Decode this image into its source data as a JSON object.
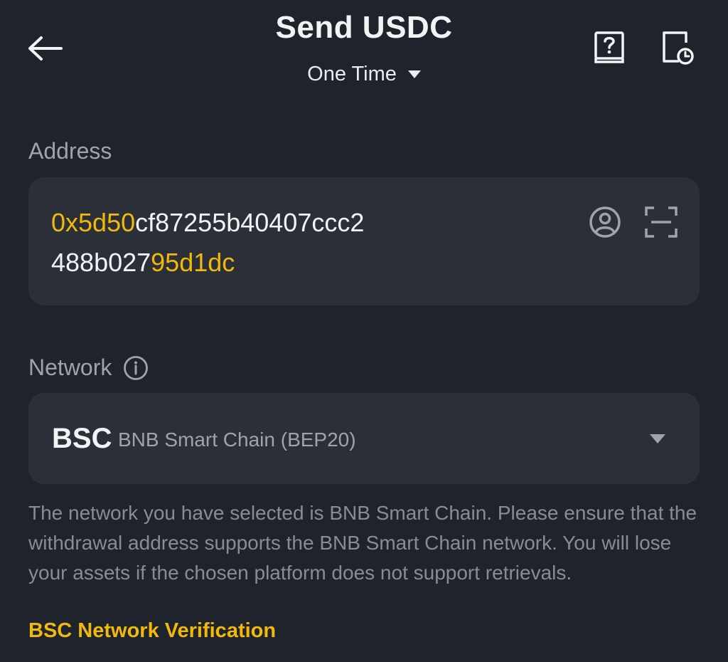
{
  "header": {
    "title": "Send USDC",
    "mode": "One Time",
    "back_icon": "arrow-left-icon",
    "help_icon": "help-book-icon",
    "history_icon": "history-clock-icon"
  },
  "address": {
    "label": "Address",
    "value_prefix": "0x5d50",
    "value_middle_line1": "cf87255b40407ccc2",
    "value_middle_line2": "488b027",
    "value_suffix": "95d1dc",
    "contact_icon": "address-book-icon",
    "scan_icon": "scan-icon"
  },
  "network": {
    "label": "Network",
    "info_icon": "info-icon",
    "code": "BSC",
    "name": "BNB Smart Chain (BEP20)"
  },
  "notice": {
    "text": "The network you have selected is BNB Smart Chain. Please ensure that the withdrawal address supports the BNB Smart Chain network. You will lose your assets if the chosen platform does not support retrievals.",
    "link": "BSC Network Verification"
  },
  "colors": {
    "background": "#1f232b",
    "field_background": "#2a2f38",
    "accent": "#f0b90b",
    "text_primary": "#f2f3f5",
    "text_secondary": "#9ea3ad"
  }
}
